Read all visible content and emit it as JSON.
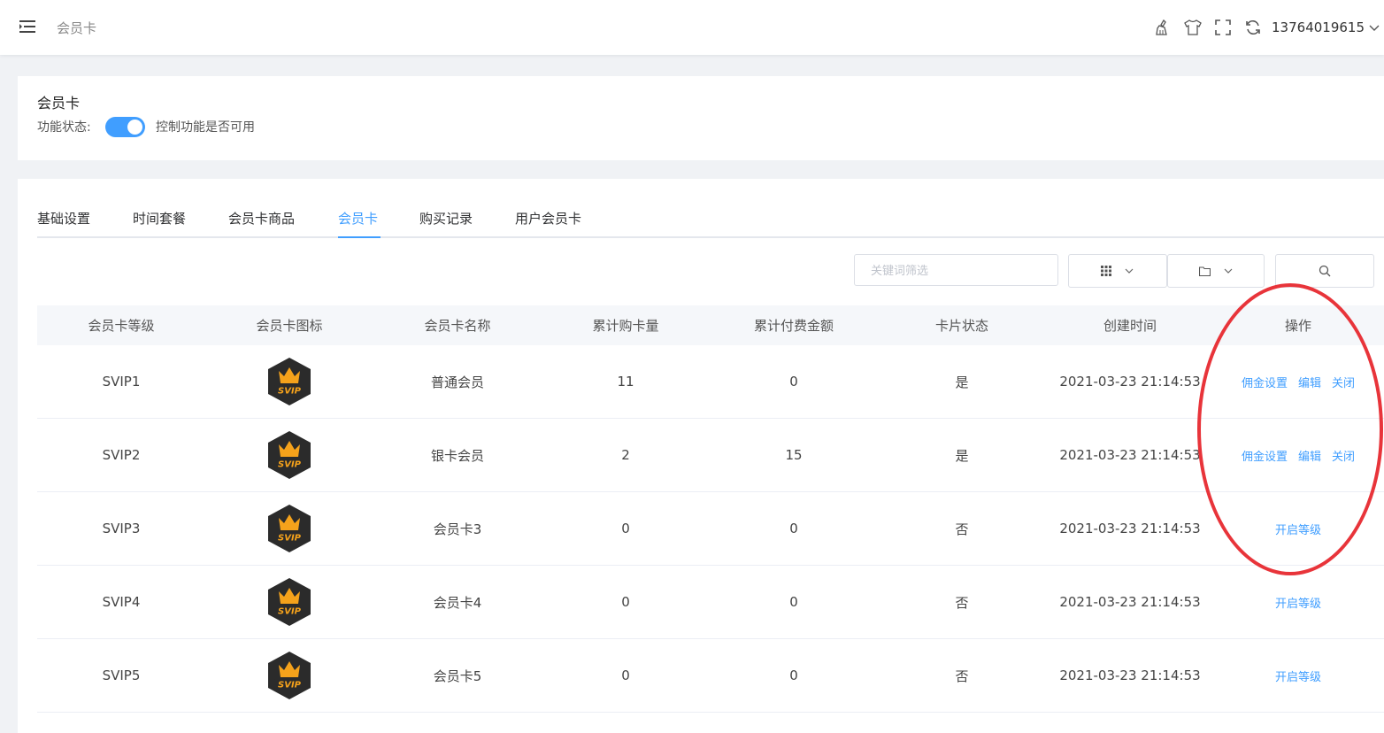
{
  "header": {
    "breadcrumb": "会员卡",
    "user": "13764019615",
    "tools": [
      "broom-icon",
      "shirt-icon",
      "fullscreen-icon",
      "refresh-icon"
    ]
  },
  "feature": {
    "title": "会员卡",
    "status_label": "功能状态:",
    "enabled": true,
    "description": "控制功能是否可用"
  },
  "tabs": [
    {
      "label": "基础设置"
    },
    {
      "label": "时间套餐"
    },
    {
      "label": "会员卡商品"
    },
    {
      "label": "会员卡",
      "active": true
    },
    {
      "label": "购买记录"
    },
    {
      "label": "用户会员卡"
    }
  ],
  "filter": {
    "keyword_placeholder": "关键词筛选"
  },
  "table": {
    "columns": [
      "会员卡等级",
      "会员卡图标",
      "会员卡名称",
      "累计购卡量",
      "累计付费金额",
      "卡片状态",
      "创建时间",
      "操作"
    ],
    "badge_text": "SVIP",
    "rows": [
      {
        "level": "SVIP1",
        "name": "普通会员",
        "count": "11",
        "amount": "0",
        "status": "是",
        "created": "2021-03-23 21:14:53",
        "actions": [
          "佣金设置",
          "编辑",
          "关闭"
        ]
      },
      {
        "level": "SVIP2",
        "name": "银卡会员",
        "count": "2",
        "amount": "15",
        "status": "是",
        "created": "2021-03-23 21:14:53",
        "actions": [
          "佣金设置",
          "编辑",
          "关闭"
        ]
      },
      {
        "level": "SVIP3",
        "name": "会员卡3",
        "count": "0",
        "amount": "0",
        "status": "否",
        "created": "2021-03-23 21:14:53",
        "actions": [
          "开启等级"
        ]
      },
      {
        "level": "SVIP4",
        "name": "会员卡4",
        "count": "0",
        "amount": "0",
        "status": "否",
        "created": "2021-03-23 21:14:53",
        "actions": [
          "开启等级"
        ]
      },
      {
        "level": "SVIP5",
        "name": "会员卡5",
        "count": "0",
        "amount": "0",
        "status": "否",
        "created": "2021-03-23 21:14:53",
        "actions": [
          "开启等级"
        ]
      }
    ]
  },
  "colors": {
    "accent": "#409eff",
    "annotation": "#e8343a",
    "badge_bg": "#2b2b2b",
    "badge_gold": "#f5a21b"
  }
}
